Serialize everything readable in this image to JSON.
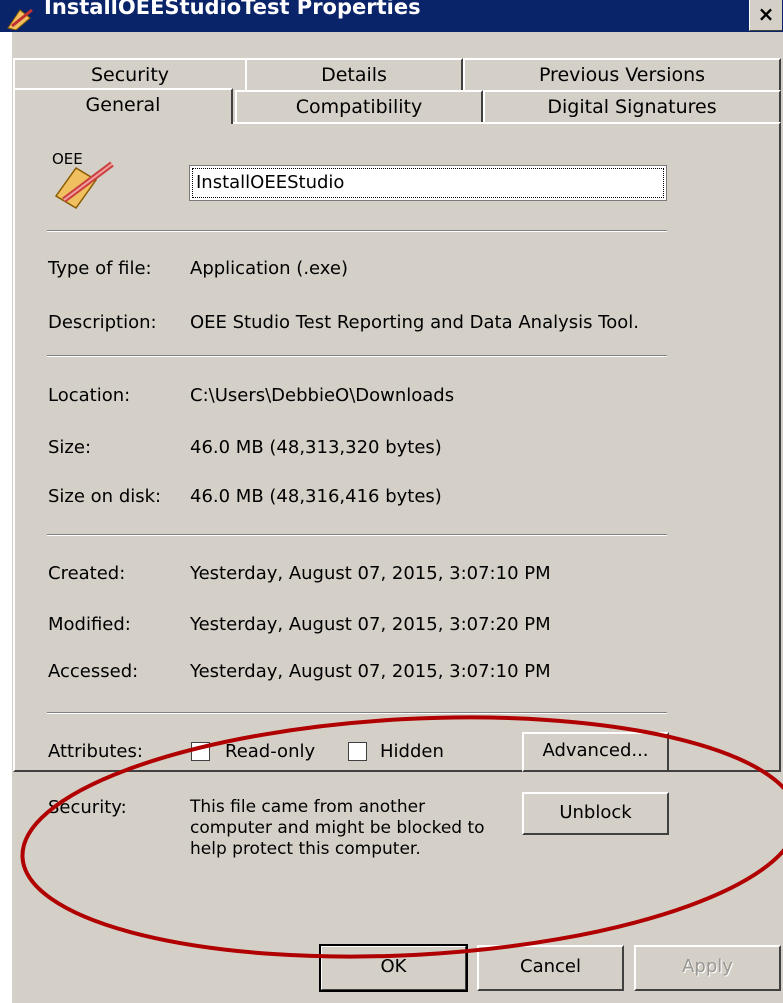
{
  "window": {
    "title": "InstallOEEStudioTest Properties",
    "close_label": "×"
  },
  "tabs": {
    "row1": [
      "Security",
      "Details",
      "Previous Versions"
    ],
    "row2": [
      "General",
      "Compatibility",
      "Digital Signatures"
    ]
  },
  "general": {
    "icon_label": "OEE",
    "file_name": "InstallOEEStudio",
    "type_label": "Type of file:",
    "type_value": "Application (.exe)",
    "desc_label": "Description:",
    "desc_value": "OEE Studio Test Reporting and Data Analysis Tool.",
    "location_label": "Location:",
    "location_value": "C:\\Users\\DebbieO\\Downloads",
    "size_label": "Size:",
    "size_value": "46.0 MB (48,313,320 bytes)",
    "size_disk_label": "Size on disk:",
    "size_disk_value": "46.0 MB (48,316,416 bytes)",
    "created_label": "Created:",
    "created_value": "Yesterday, August 07, 2015, 3:07:10 PM",
    "modified_label": "Modified:",
    "modified_value": "Yesterday, August 07, 2015, 3:07:20 PM",
    "accessed_label": "Accessed:",
    "accessed_value": "Yesterday, August 07, 2015, 3:07:10 PM",
    "attributes_label": "Attributes:",
    "readonly_label": "Read-only",
    "hidden_label": "Hidden",
    "advanced_label": "Advanced...",
    "security_label": "Security:",
    "security_text": [
      "This file came from another",
      "computer and might be blocked to",
      "help protect this computer."
    ],
    "unblock_label": "Unblock"
  },
  "buttons": {
    "ok": "OK",
    "cancel": "Cancel",
    "apply": "Apply"
  },
  "colors": {
    "annotation_ellipse": "#b00000",
    "titlebar": "#0a246a",
    "dialog_face": "#d4d0c8"
  }
}
